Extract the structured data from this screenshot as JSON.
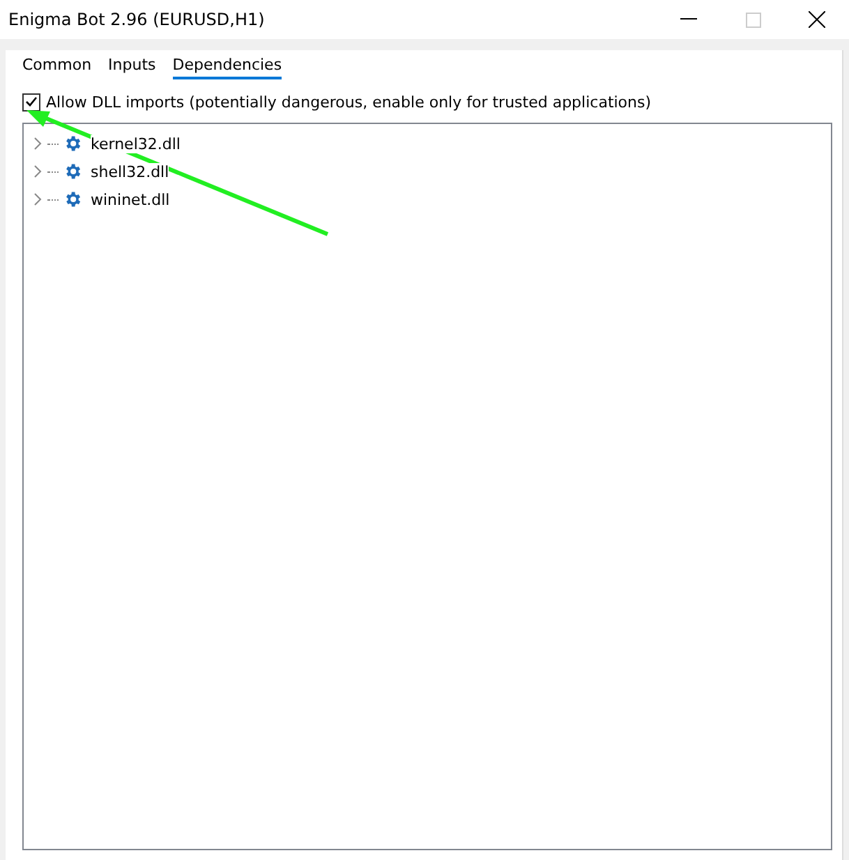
{
  "window": {
    "title": "Enigma Bot 2.96 (EURUSD,H1)"
  },
  "tabs": [
    {
      "label": "Common",
      "selected": false
    },
    {
      "label": "Inputs",
      "selected": false
    },
    {
      "label": "Dependencies",
      "selected": true
    }
  ],
  "allow_dll": {
    "label": "Allow DLL imports (potentially dangerous, enable only for trusted applications)",
    "checked": true
  },
  "tree": [
    {
      "label": "kernel32.dll",
      "expanded": false
    },
    {
      "label": "shell32.dll",
      "expanded": false
    },
    {
      "label": "wininet.dll",
      "expanded": false
    }
  ]
}
